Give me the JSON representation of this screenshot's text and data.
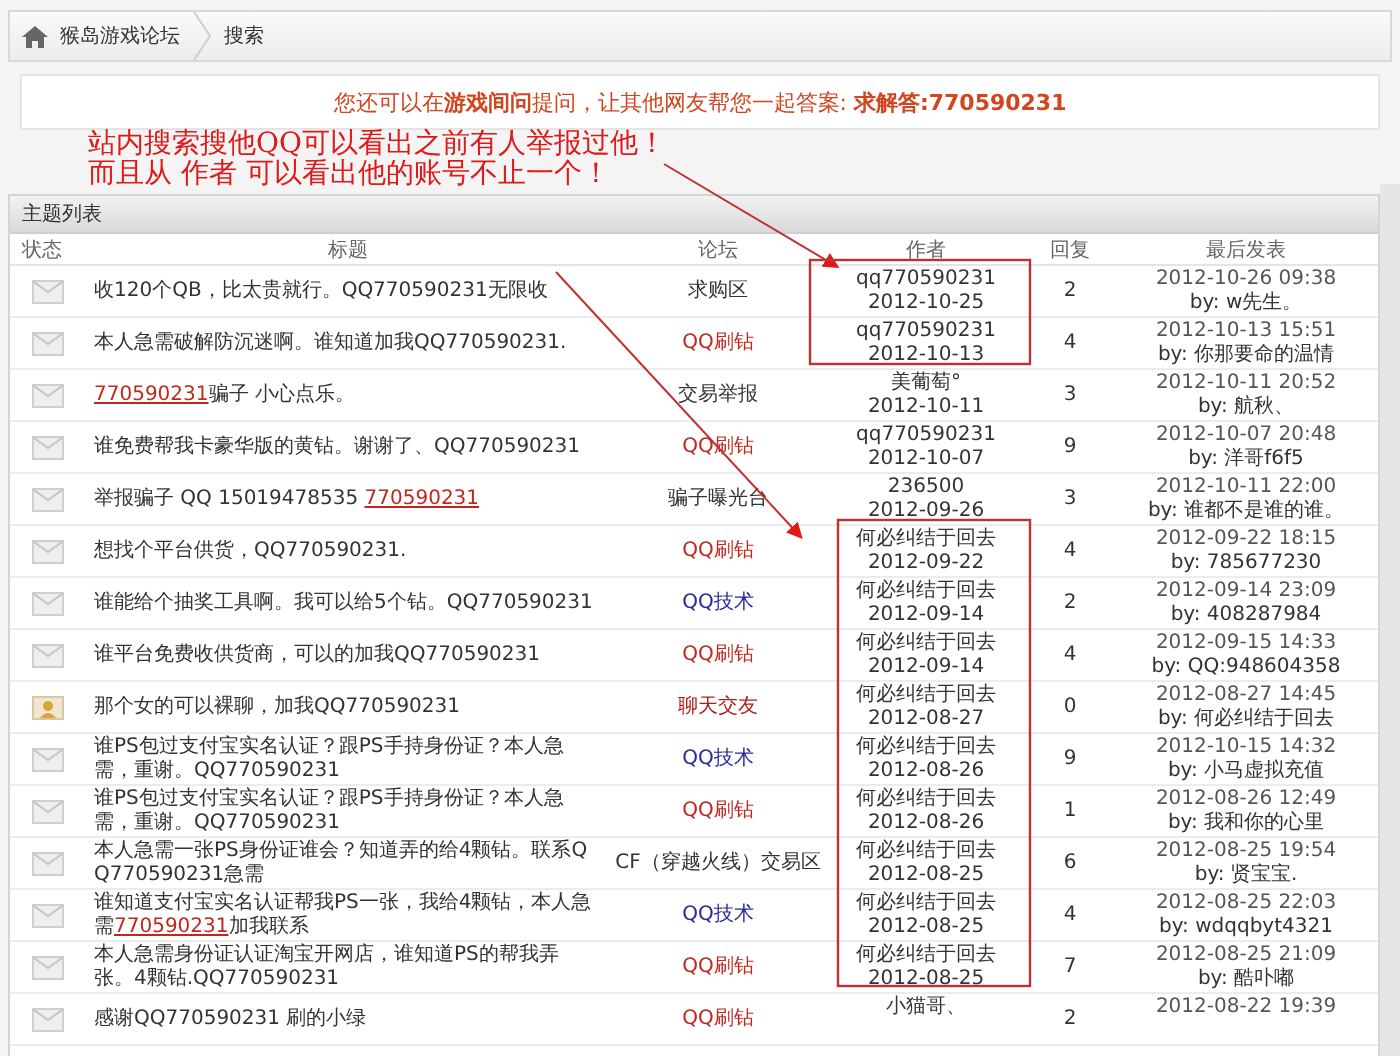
{
  "breadcrumb": {
    "items": [
      "猴岛游戏论坛",
      "搜索"
    ]
  },
  "notice": "您还可以在**游戏间问**提问，让其他网友帮您一起答案: **求解答:770590231**",
  "annotation": {
    "lines": [
      "站内搜索搜他QQ可以看出之前有人举报过他！",
      "而且从  作者  可以看出他的账号不止一个！"
    ]
  },
  "panel": {
    "title": "主题列表",
    "columns": [
      "状态",
      "标题",
      "论坛",
      "作者",
      "回复",
      "最后发表"
    ],
    "rows": [
      {
        "kind": "normal",
        "title": [
          {
            "text": "收120个QB，比太贵就行。QQ770590231无限收",
            "link": false
          }
        ],
        "forum": "求购区",
        "color": "#333333",
        "author": "qq770590231",
        "date": "2012-10-25",
        "replies": "2",
        "last_time": "2012-10-26 09:38",
        "last_by": "by: w先生。"
      },
      {
        "kind": "normal",
        "title": [
          {
            "text": "本人急需破解防沉迷啊。谁知道加我QQ770590231.",
            "link": false
          }
        ],
        "forum": "QQ刷钻",
        "color": "#c0281e",
        "author": "qq770590231",
        "date": "2012-10-13",
        "replies": "4",
        "last_time": "2012-10-13 15:51",
        "last_by": "by: 你那要命的温情"
      },
      {
        "kind": "normal",
        "title": [
          {
            "text": "770590231",
            "link": true
          },
          {
            "text": "骗子 小心点乐。",
            "link": false
          }
        ],
        "forum": "交易举报",
        "color": "#333333",
        "author": "美葡萄°",
        "date": "2012-10-11",
        "replies": "3",
        "last_time": "2012-10-11 20:52",
        "last_by": "by: 航秋、"
      },
      {
        "kind": "normal",
        "title": [
          {
            "text": "谁免费帮我卡豪华版的黄钻。谢谢了、QQ770590231",
            "link": false
          }
        ],
        "forum": "QQ刷钻",
        "color": "#c0281e",
        "author": "qq770590231",
        "date": "2012-10-07",
        "replies": "9",
        "last_time": "2012-10-07 20:48",
        "last_by": "by: 洋哥f6f5"
      },
      {
        "kind": "normal",
        "title": [
          {
            "text": "举报骗子 QQ 15019478535 ",
            "link": false
          },
          {
            "text": "770590231",
            "link": true
          }
        ],
        "forum": "骗子曝光台",
        "color": "#333333",
        "author": "236500",
        "date": "2012-09-26",
        "replies": "3",
        "last_time": "2012-10-11 22:00",
        "last_by": "by: 谁都不是谁的谁。"
      },
      {
        "kind": "normal",
        "title": [
          {
            "text": "想找个平台供货，QQ770590231.",
            "link": false
          }
        ],
        "forum": "QQ刷钻",
        "color": "#c0281e",
        "author": "何必纠结于回去",
        "date": "2012-09-22",
        "replies": "4",
        "last_time": "2012-09-22 18:15",
        "last_by": "by: 785677230"
      },
      {
        "kind": "normal",
        "title": [
          {
            "text": "谁能给个抽奖工具啊。我可以给5个钻。QQ770590231",
            "link": false
          }
        ],
        "forum": "QQ技术",
        "color": "#2a2a9a",
        "author": "何必纠结于回去",
        "date": "2012-09-14",
        "replies": "2",
        "last_time": "2012-09-14 23:09",
        "last_by": "by: 408287984"
      },
      {
        "kind": "normal",
        "title": [
          {
            "text": "谁平台免费收供货商，可以的加我QQ770590231",
            "link": false
          }
        ],
        "forum": "QQ刷钻",
        "color": "#c0281e",
        "author": "何必纠结于回去",
        "date": "2012-09-14",
        "replies": "4",
        "last_time": "2012-09-15 14:33",
        "last_by": "by: QQ:948604358"
      },
      {
        "kind": "person",
        "title": [
          {
            "text": "那个女的可以裸聊，加我QQ770590231",
            "link": false
          }
        ],
        "forum": "聊天交友",
        "color": "#b01e1e",
        "author": "何必纠结于回去",
        "date": "2012-08-27",
        "replies": "0",
        "last_time": "2012-08-27 14:45",
        "last_by": "by: 何必纠结于回去"
      },
      {
        "kind": "normal",
        "title": [
          {
            "text": "谁PS包过支付宝实名认证？跟PS手持身份证？本人急需，重谢。QQ770590231",
            "link": false
          }
        ],
        "forum": "QQ技术",
        "color": "#2a2a9a",
        "author": "何必纠结于回去",
        "date": "2012-08-26",
        "replies": "9",
        "last_time": "2012-10-15 14:32",
        "last_by": "by: 小马虚拟充值"
      },
      {
        "kind": "normal",
        "title": [
          {
            "text": "谁PS包过支付宝实名认证？跟PS手持身份证？本人急需，重谢。QQ770590231",
            "link": false
          }
        ],
        "forum": "QQ刷钻",
        "color": "#c0281e",
        "author": "何必纠结于回去",
        "date": "2012-08-26",
        "replies": "1",
        "last_time": "2012-08-26 12:49",
        "last_by": "by: 我和你的心里"
      },
      {
        "kind": "normal",
        "title": [
          {
            "text": "本人急需一张PS身份证谁会？知道弄的给4颗钻。联系QQ770590231急需",
            "link": false
          }
        ],
        "forum": "CF（穿越火线）交易区",
        "color": "#333333",
        "author": "何必纠结于回去",
        "date": "2012-08-25",
        "replies": "6",
        "last_time": "2012-08-25 19:54",
        "last_by": "by: 贤宝宝."
      },
      {
        "kind": "normal",
        "title": [
          {
            "text": "谁知道支付宝实名认证帮我PS一张，我给4颗钻，本人急需",
            "link": false
          },
          {
            "text": "770590231",
            "link": true
          },
          {
            "text": "加我联系",
            "link": false
          }
        ],
        "forum": "QQ技术",
        "color": "#2a2a9a",
        "author": "何必纠结于回去",
        "date": "2012-08-25",
        "replies": "4",
        "last_time": "2012-08-25 22:03",
        "last_by": "by: wdqqbyt4321"
      },
      {
        "kind": "normal",
        "title": [
          {
            "text": "本人急需身份证认证淘宝开网店，谁知道PS的帮我弄张。4颗钻.QQ770590231",
            "link": false
          }
        ],
        "forum": "QQ刷钻",
        "color": "#c0281e",
        "author": "何必纠结于回去",
        "date": "2012-08-25",
        "replies": "7",
        "last_time": "2012-08-25 21:09",
        "last_by": "by: 酷卟嘟"
      },
      {
        "kind": "normal",
        "title": [
          {
            "text": "感谢QQ770590231 刷的小绿",
            "link": false
          }
        ],
        "forum": "QQ刷钻",
        "color": "#c0281e",
        "author": "小猫哥、",
        "replies": "2",
        "last_time": "2012-08-22 19:39"
      }
    ]
  }
}
